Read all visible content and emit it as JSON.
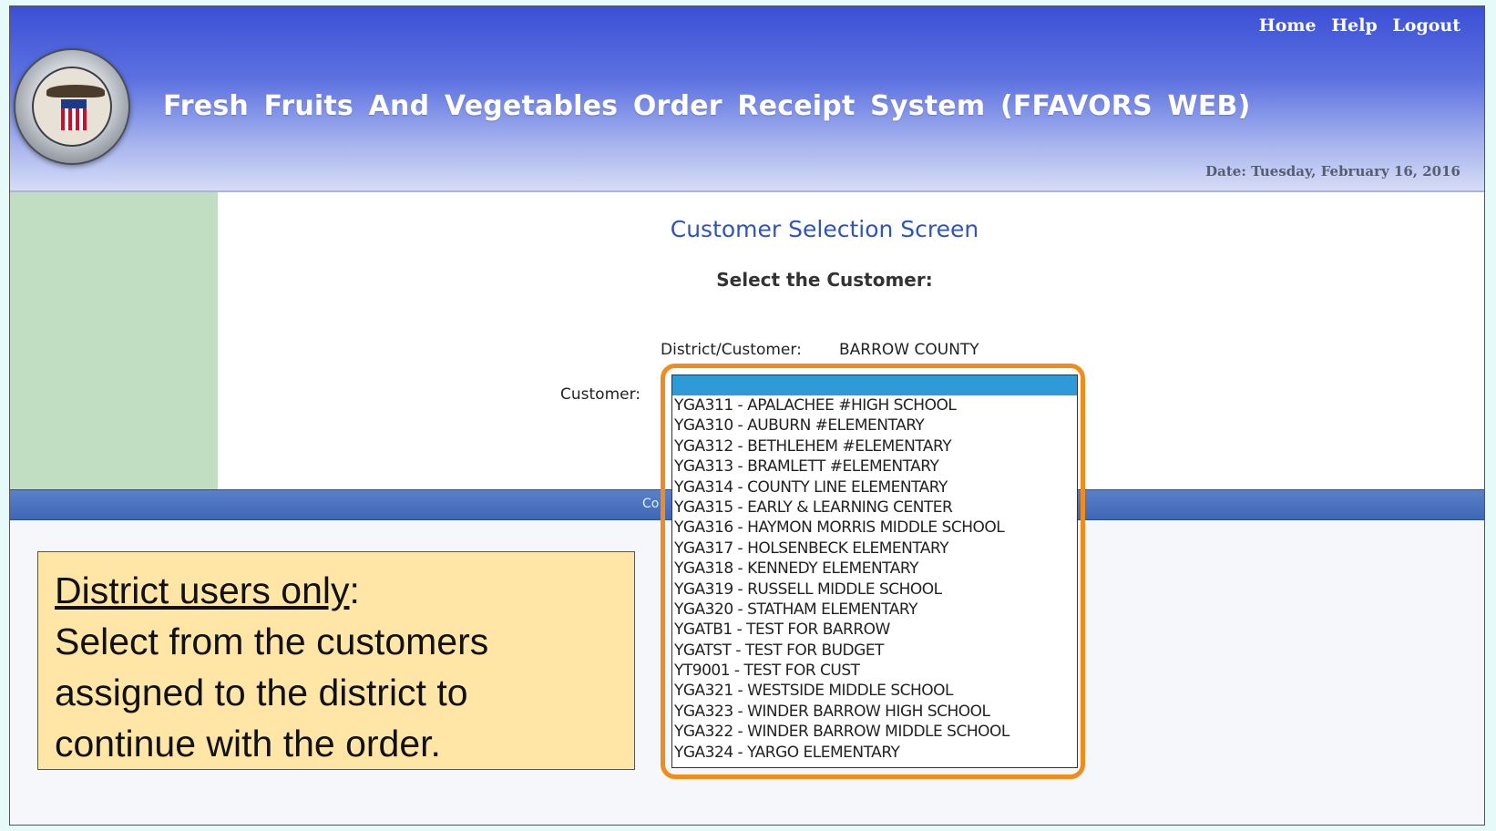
{
  "header": {
    "links": [
      "Home",
      "Help",
      "Logout"
    ],
    "title": "Fresh Fruits And Vegetables Order Receipt System (FFAVORS WEB)",
    "date": "Date: Tuesday, February 16, 2016",
    "logo_icon": "dla-seal-icon"
  },
  "main": {
    "screen_title": "Customer Selection Screen",
    "select_label": "Select the Customer:",
    "district_label": "District/Customer:",
    "district_value": "BARROW COUNTY",
    "customer_label": "Customer:",
    "customer_options": [
      "",
      "YGA311 - APALACHEE #HIGH SCHOOL",
      "YGA310 - AUBURN #ELEMENTARY",
      "YGA312 - BETHLEHEM #ELEMENTARY",
      "YGA313 - BRAMLETT #ELEMENTARY",
      "YGA314 - COUNTY LINE ELEMENTARY",
      "YGA315 - EARLY & LEARNING CENTER",
      "YGA316 - HAYMON MORRIS MIDDLE SCHOOL",
      "YGA317 - HOLSENBECK ELEMENTARY",
      "YGA318 - KENNEDY ELEMENTARY",
      "YGA319 - RUSSELL MIDDLE SCHOOL",
      "YGA320 - STATHAM ELEMENTARY",
      "YGATB1 - TEST FOR BARROW",
      "YGATST - TEST FOR BUDGET",
      "YT9001 - TEST FOR CUST",
      "YGA321 - WESTSIDE MIDDLE SCHOOL",
      "YGA323 - WINDER BARROW HIGH SCHOOL",
      "YGA322 - WINDER BARROW MIDDLE SCHOOL",
      "YGA324 - YARGO ELEMENTARY"
    ],
    "selected_index": 0
  },
  "footer_bar": {
    "partial_text": "Co"
  },
  "note": {
    "underlined": "District users only",
    "colon": ":",
    "lines": [
      "Select from the customers",
      "assigned to the district to",
      "continue with the order."
    ]
  },
  "colors": {
    "callout_border": "#f08c1c",
    "note_background": "#ffe6a7",
    "sidebar": "#c2dec2",
    "selection": "#2f9ad8"
  }
}
